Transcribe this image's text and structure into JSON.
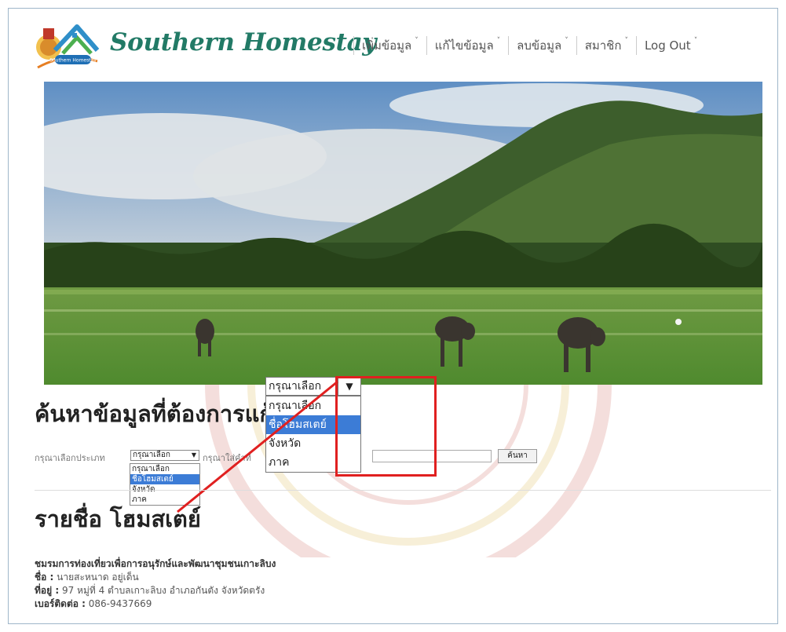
{
  "header": {
    "logo_label": "Southern Homestay",
    "brand_title": "Southern Homestay",
    "nav": [
      {
        "label": "เพิ่มข้อมูล"
      },
      {
        "label": "แก้ไขข้อมูล"
      },
      {
        "label": "ลบข้อมูล"
      },
      {
        "label": "สมาชิก"
      },
      {
        "label": "Log Out"
      }
    ]
  },
  "search": {
    "title": "ค้นหาข้อมูลที่ต้องการแก้",
    "type_label": "กรุณาเลือกประเภท",
    "type_selected": "กรุณาเลือก",
    "keyword_label": "กรุณาใส่คำที่",
    "search_button": "ค้นหา",
    "options": [
      "กรุณาเลือก",
      "ชื่อโฮมสเตย์",
      "จังหวัด",
      "ภาค"
    ],
    "highlighted_option": "ชื่อโฮมสเตย์"
  },
  "zoom": {
    "selected": "กรุณาเลือก",
    "options": [
      "กรุณาเลือก",
      "ชื่อโฮมสเตย์",
      "จังหวัด",
      "ภาค"
    ]
  },
  "list": {
    "title": "รายชื่อ โฮมสเตย์"
  },
  "record": {
    "org": "ชมรมการท่องเที่ยวเพื่อการอนุรักษ์และพัฒนาชุมชนเกาะลิบง",
    "name_label": "ชื่อ :",
    "name_value": "นายสะหนาด อยู่เด็น",
    "address_label": "ที่อยู่ :",
    "address_value": "97 หมู่ที่ 4 ตำบลเกาะลิบง อำเภอกันตัง จังหวัดตรัง",
    "phone_label": "เบอร์ติดต่อ :",
    "phone_value": "086-9437669"
  },
  "colors": {
    "brand": "#227a66",
    "highlight": "#3c7cd6",
    "annotation": "#e02020"
  }
}
